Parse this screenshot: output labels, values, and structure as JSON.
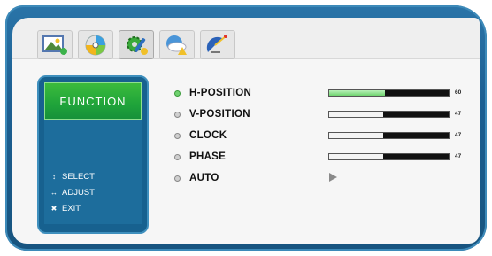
{
  "window_title": "FUNCTION",
  "icons": [
    {
      "name": "picture-icon",
      "active": false
    },
    {
      "name": "color-disc-icon",
      "active": false
    },
    {
      "name": "function-gear-icon",
      "active": true
    },
    {
      "name": "cloud-weather-icon",
      "active": false
    },
    {
      "name": "satellite-icon",
      "active": false
    }
  ],
  "sidebar": {
    "title": "FUNCTION",
    "hints": [
      {
        "glyph": "↕",
        "label": "SELECT"
      },
      {
        "glyph": "↔",
        "label": "ADJUST"
      },
      {
        "glyph": "✖",
        "label": "EXIT"
      }
    ]
  },
  "menu": {
    "items": [
      {
        "label": "H-POSITION",
        "value": "60",
        "level": 0.47,
        "selected": true
      },
      {
        "label": "V-POSITION",
        "value": "47",
        "level": 0.45,
        "selected": false
      },
      {
        "label": "CLOCK",
        "value": "47",
        "level": 0.45,
        "selected": false
      },
      {
        "label": "PHASE",
        "value": "47",
        "level": 0.45,
        "selected": false
      },
      {
        "label": "AUTO",
        "value": "",
        "level": null,
        "selected": false
      }
    ]
  },
  "colors": {
    "frame": "#1c5f92",
    "accent_green": "#1fa43a",
    "panel": "#efefef"
  }
}
